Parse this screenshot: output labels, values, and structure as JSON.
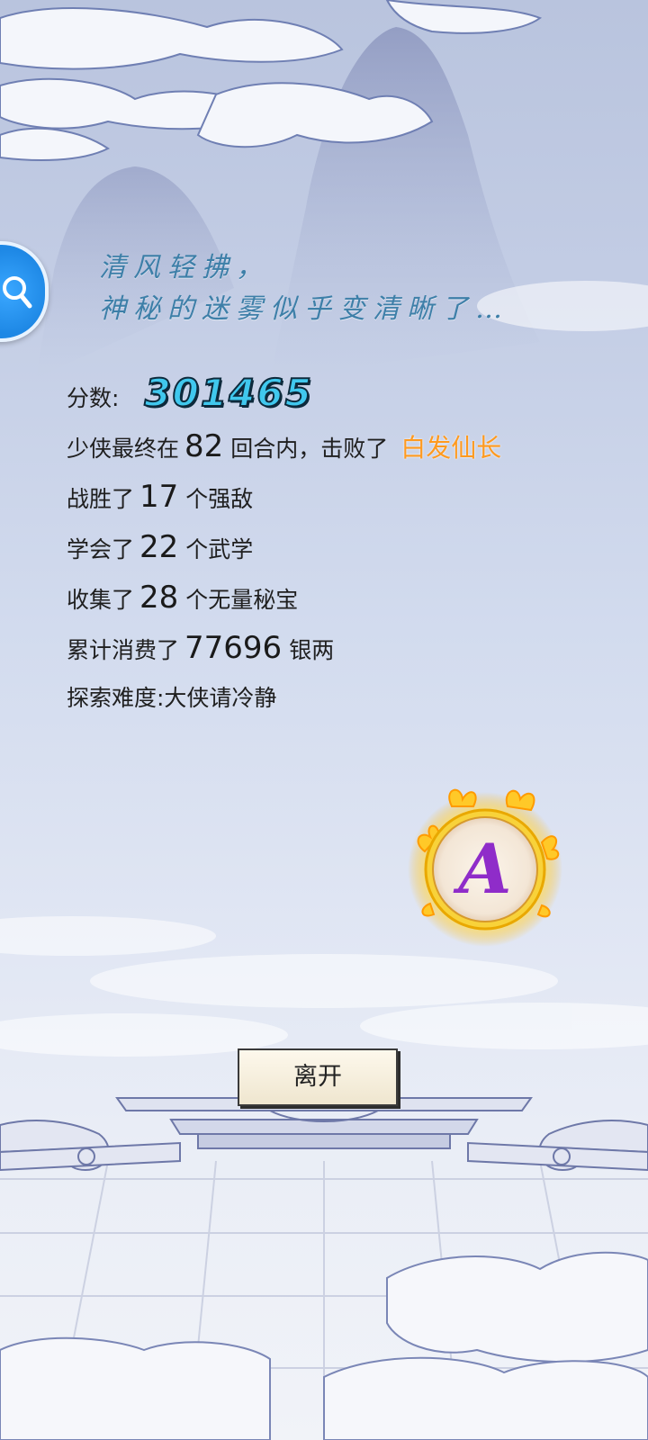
{
  "poem": {
    "line1": "清风轻拂，",
    "line2": "神秘的迷雾似乎变清晰了…"
  },
  "result": {
    "score_label": "分数:",
    "score": "301465",
    "rounds_prefix": "少侠最终在",
    "rounds": "82",
    "rounds_suffix": "回合内，击败了",
    "boss_name": "白发仙长",
    "enemies_prefix": "战胜了",
    "enemies": "17",
    "enemies_suffix": "个强敌",
    "skills_prefix": "学会了",
    "skills": "22",
    "skills_suffix": "个武学",
    "treasures_prefix": "收集了",
    "treasures": "28",
    "treasures_suffix": "个无量秘宝",
    "silver_prefix": "累计消费了",
    "silver": "77696",
    "silver_suffix": "银两",
    "difficulty": "探索难度:大侠请冷静"
  },
  "grade": {
    "letter": "A",
    "ring_color": "#f6c21b",
    "letter_color": "#8f2cc9"
  },
  "buttons": {
    "leave": "离开"
  },
  "icons": {
    "search": "search-magnifier-icon"
  },
  "colors": {
    "score": "#40c8ee",
    "boss": "#ff9a1f",
    "poem": "#3d7fa8"
  }
}
